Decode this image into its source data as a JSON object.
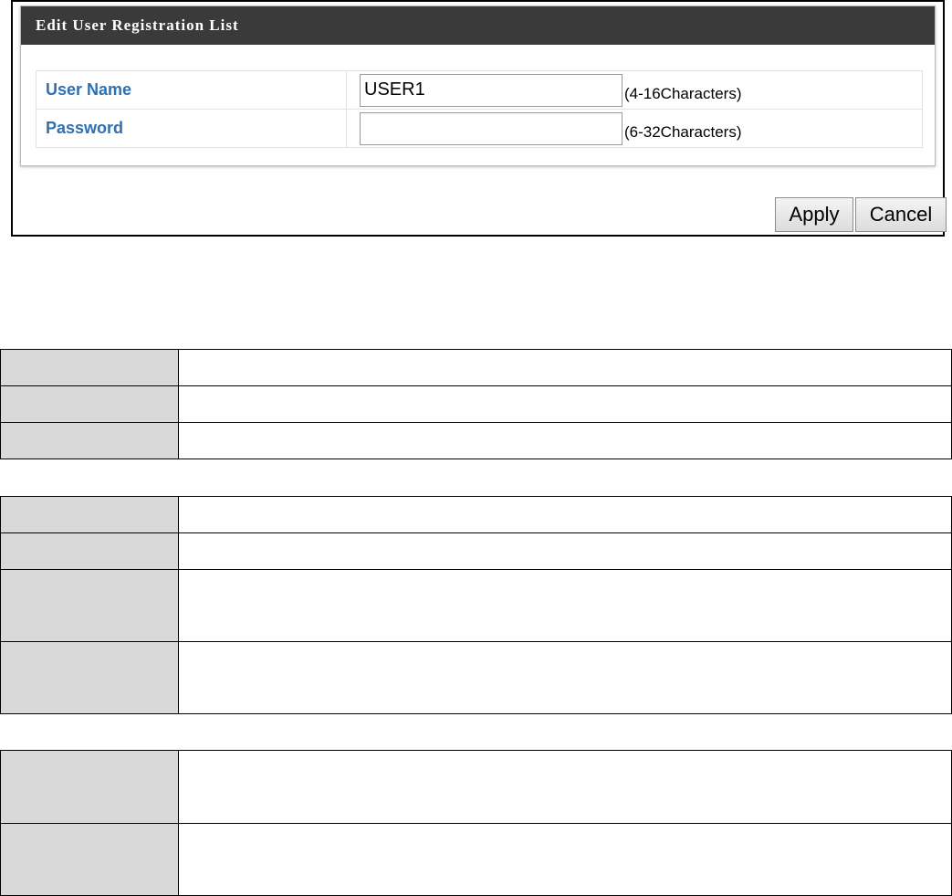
{
  "dialog": {
    "title": "Edit User Registration List",
    "fields": [
      {
        "label": "User Name",
        "value": "USER1",
        "placeholder": "",
        "hint": "(4-16Characters)"
      },
      {
        "label": "Password",
        "value": "",
        "placeholder": "",
        "hint": "(6-32Characters)"
      }
    ],
    "buttons": {
      "apply": "Apply",
      "cancel": "Cancel"
    }
  },
  "colors": {
    "header_bg": "#3a3a3a",
    "label_blue": "#2f6fb3",
    "key_cell_gray": "#d9d9d9"
  }
}
